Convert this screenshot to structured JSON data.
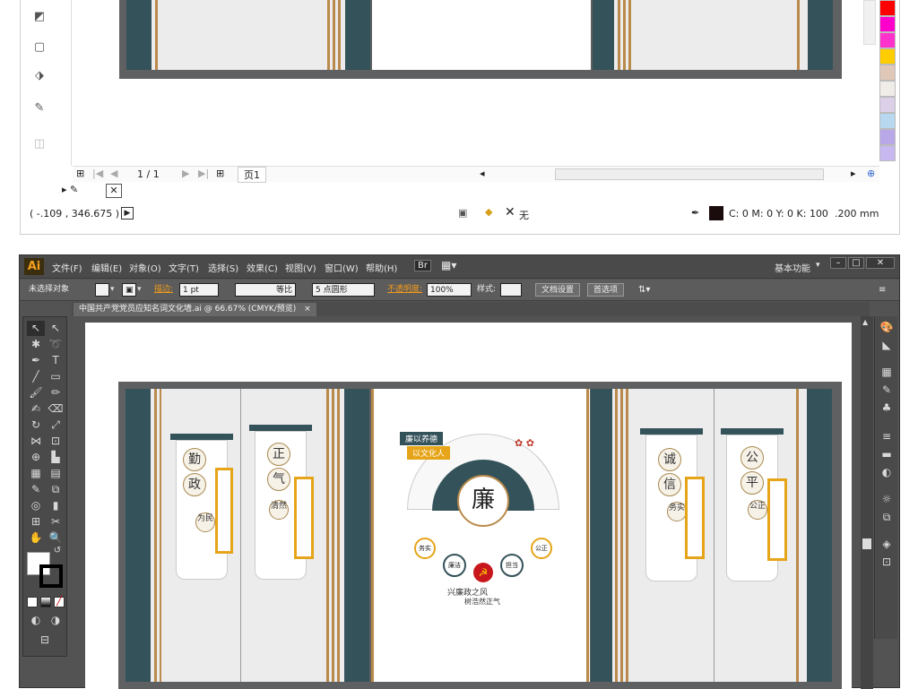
{
  "top_pane": {
    "page_nav": {
      "page_counter": "1 / 1",
      "page_label": "页1"
    },
    "status": {
      "coords": "( -.109 , 346.675 )",
      "no_fill_label": "无",
      "color_values": "C: 0 M: 0 Y: 0 K: 100",
      "stroke_width": ".200 mm"
    },
    "swatch_colors": [
      "#ff0000",
      "#ff00cc",
      "#ff33cc",
      "#ffcc00",
      "#e0c8b8",
      "#f0ece8",
      "#dcd0e8",
      "#b8d8f0",
      "#b8a8e8",
      "#c8b8f0"
    ]
  },
  "ai_window": {
    "logo": "Ai",
    "menu": [
      "文件(F)",
      "编辑(E)",
      "对象(O)",
      "文字(T)",
      "选择(S)",
      "效果(C)",
      "视图(V)",
      "窗口(W)",
      "帮助(H)"
    ],
    "bridge_label": "Br",
    "workspace": "基本功能",
    "window_buttons": [
      "–",
      "□",
      "✕"
    ],
    "control": {
      "selection_state": "未选择对象",
      "stroke_label": "描边:",
      "stroke_value": "1 pt",
      "line_style": "等比",
      "brush": "5 点圆形",
      "opacity_label": "不透明度:",
      "opacity_value": "100%",
      "style_label": "样式:",
      "doc_setup": "文档设置",
      "preferences": "首选项"
    },
    "doc_tab": {
      "title": "中国共产党党员应知名词文化墙.ai @ 66.67% (CMYK/预览)",
      "close": "×"
    }
  },
  "artwork": {
    "left_scroll_1": [
      "勤",
      "政"
    ],
    "left_scroll_1_badge": "为民",
    "left_scroll_2": [
      "正",
      "气"
    ],
    "left_scroll_2_badge": "清然",
    "right_scroll_1": [
      "诚",
      "信"
    ],
    "right_scroll_1_badge": "务实",
    "right_scroll_2": [
      "公",
      "平"
    ],
    "right_scroll_2_badge": "公正",
    "center": {
      "banner_1": "廉以养德",
      "banner_2": "以文化人",
      "main_char": "廉",
      "small_left": "务实",
      "small_right": "公正",
      "circle_left": "廉洁",
      "circle_right": "担当",
      "slogan_1": "兴廉政之风",
      "slogan_2": "树浩然正气"
    },
    "colors": {
      "teal": "#34525a",
      "gold": "#b98a4b",
      "accent_yellow": "#e6a419",
      "party_red": "#c8161d"
    }
  }
}
